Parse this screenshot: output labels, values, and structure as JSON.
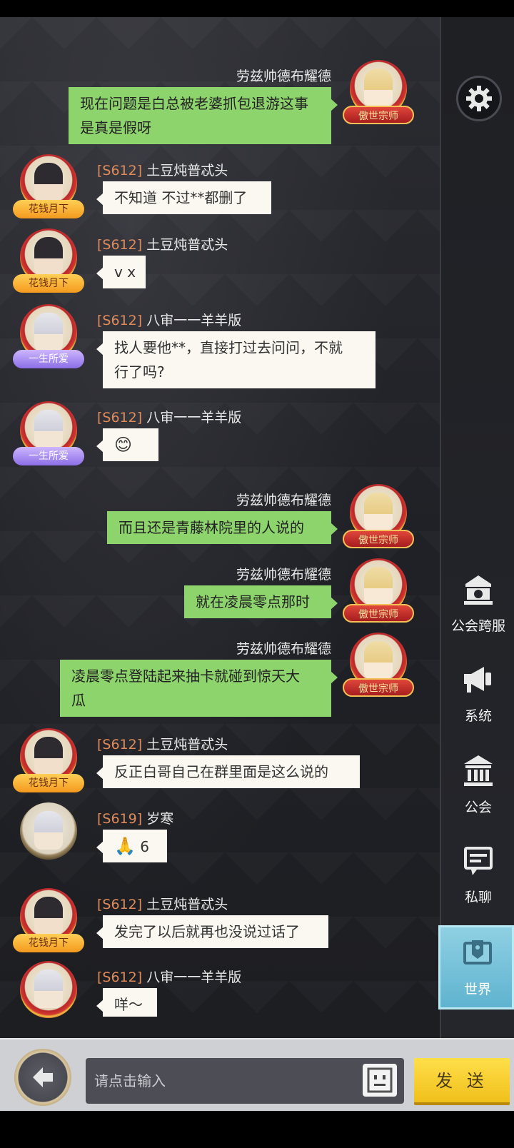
{
  "messages": [
    {
      "side": "right",
      "server": "",
      "name": "劳兹帅德布耀德",
      "lines": [
        "现在问题是白总被老婆抓包退游这事",
        "是真是假呀"
      ],
      "badge": "傲世宗师",
      "avatar": "blonde",
      "emoji": ""
    },
    {
      "side": "left",
      "server": "[S612]",
      "name": "土豆炖普忒头",
      "lines": [
        "不知道 不过**都删了"
      ],
      "badge": "花钱月下",
      "avatar": "dark",
      "emoji": ""
    },
    {
      "side": "left",
      "server": "[S612]",
      "name": "土豆炖普忒头",
      "lines": [
        "v x"
      ],
      "badge": "花钱月下",
      "avatar": "dark",
      "emoji": ""
    },
    {
      "side": "left",
      "server": "[S612]",
      "name": "八审一一羊羊版",
      "lines": [
        "找人要他**，直接打过去问问，不就",
        "行了吗?"
      ],
      "badge": "一生所爱",
      "avatar": "white",
      "emoji": ""
    },
    {
      "side": "left",
      "server": "[S612]",
      "name": "八审一一羊羊版",
      "lines": [],
      "badge": "一生所爱",
      "avatar": "white",
      "emoji": "😊"
    },
    {
      "side": "right",
      "server": "",
      "name": "劳兹帅德布耀德",
      "lines": [
        "而且还是青藤林院里的人说的"
      ],
      "badge": "傲世宗师",
      "avatar": "blonde",
      "emoji": ""
    },
    {
      "side": "right",
      "server": "",
      "name": "劳兹帅德布耀德",
      "lines": [
        "就在凌晨零点那时"
      ],
      "badge": "傲世宗师",
      "avatar": "blonde",
      "emoji": ""
    },
    {
      "side": "right",
      "server": "",
      "name": "劳兹帅德布耀德",
      "lines": [
        "凌晨零点登陆起来抽卡就碰到惊天大",
        "瓜"
      ],
      "badge": "傲世宗师",
      "avatar": "blonde",
      "emoji": ""
    },
    {
      "side": "left",
      "server": "[S612]",
      "name": "土豆炖普忒头",
      "lines": [
        "反正白哥自己在群里面是这么说的"
      ],
      "badge": "花钱月下",
      "avatar": "dark",
      "emoji": ""
    },
    {
      "side": "left",
      "server": "[S619]",
      "name": "岁寒",
      "lines": [
        "6"
      ],
      "badge": "",
      "avatar": "plain",
      "emoji": "🙏"
    },
    {
      "side": "left",
      "server": "[S612]",
      "name": "土豆炖普忒头",
      "lines": [
        "发完了以后就再也没说过话了"
      ],
      "badge": "花钱月下",
      "avatar": "dark",
      "emoji": ""
    },
    {
      "side": "left",
      "server": "[S612]",
      "name": "八审一一羊羊版",
      "lines": [
        "咩～"
      ],
      "badge": "",
      "avatar": "white",
      "emoji": ""
    }
  ],
  "sidebar": {
    "items": [
      {
        "label": "公会跨服",
        "icon": "guild-cross-server-icon"
      },
      {
        "label": "系统",
        "icon": "megaphone-icon"
      },
      {
        "label": "公会",
        "icon": "bank-icon"
      },
      {
        "label": "私聊",
        "icon": "chat-bubble-icon"
      },
      {
        "label": "世界",
        "icon": "world-icon"
      }
    ],
    "active": "世界"
  },
  "input": {
    "placeholder": "请点击输入",
    "send_label": "发 送"
  },
  "colors": {
    "my_bubble": "#8ed46d",
    "other_bubble": "#fbf8f1",
    "server_tag": "#e08a5a",
    "send_button": "#f0c01b",
    "active_tab": "#5fb3cf"
  }
}
